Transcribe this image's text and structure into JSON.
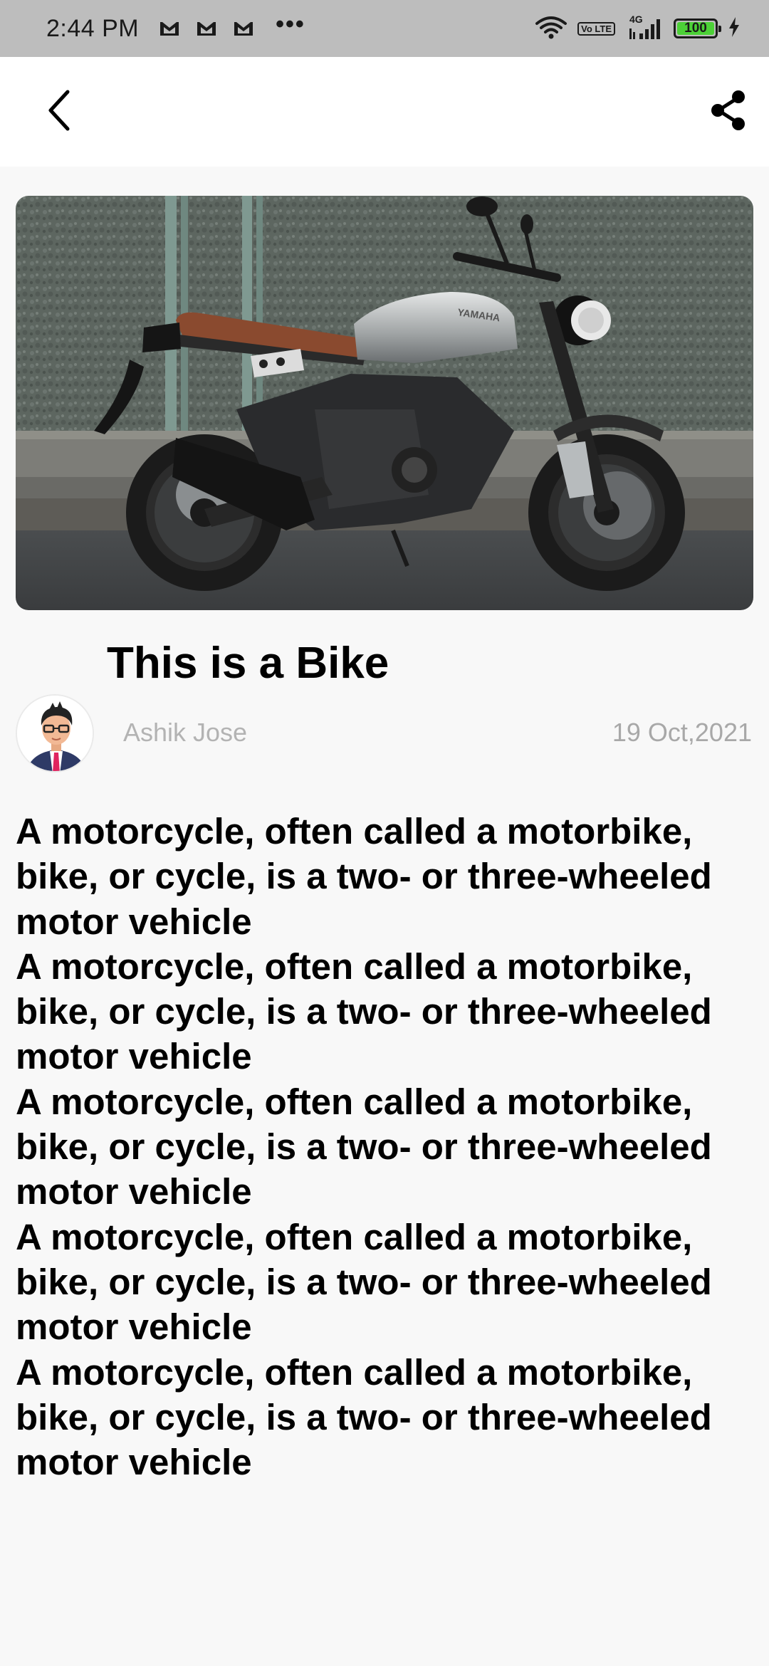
{
  "status_bar": {
    "time": "2:44 PM",
    "more_indicator": "•••",
    "volte_label": "Vo LTE",
    "network_label": "4G",
    "battery_level": "100",
    "battery_percent": 100,
    "icons": [
      "gmail-icon",
      "gmail-icon",
      "gmail-icon",
      "wifi-icon",
      "volte-icon",
      "signal-icon",
      "battery-icon",
      "charging-icon"
    ]
  },
  "app_bar": {
    "back_icon": "chevron-left-icon",
    "share_icon": "share-icon"
  },
  "post": {
    "title": "This is a Bike",
    "author": "Ashik Jose",
    "date": "19 Oct,2021",
    "image_brand_text": "YAMAHA",
    "paragraphs": [
      "A motorcycle, often called a motorbike, bike, or cycle, is a two- or three-wheeled motor vehicle",
      "A motorcycle, often called a motorbike, bike, or cycle, is a two- or three-wheeled motor vehicle",
      "A motorcycle, often called a motorbike, bike, or cycle, is a two- or three-wheeled motor vehicle",
      "A motorcycle, often called a motorbike, bike, or cycle, is a two- or three-wheeled motor vehicle",
      "A motorcycle, often called a motorbike, bike, or cycle, is a two- or three-wheeled motor vehicle"
    ]
  },
  "colors": {
    "status_bar_bg": "#bdbdbd",
    "app_bar_bg": "#ffffff",
    "page_bg": "#f8f8f8",
    "muted_text": "#b3b3b3",
    "battery_green": "#4cd137"
  }
}
